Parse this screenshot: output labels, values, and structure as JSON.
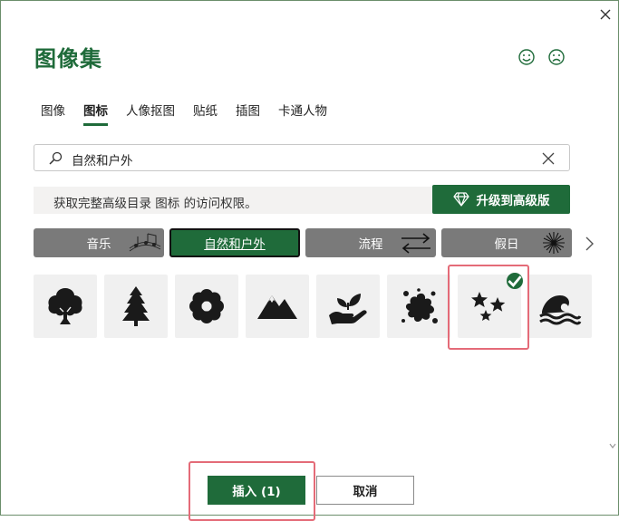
{
  "title": "图像集",
  "tabs": [
    {
      "label": "图像",
      "active": false
    },
    {
      "label": "图标",
      "active": true
    },
    {
      "label": "人像抠图",
      "active": false
    },
    {
      "label": "贴纸",
      "active": false
    },
    {
      "label": "插图",
      "active": false
    },
    {
      "label": "卡通人物",
      "active": false
    }
  ],
  "search": {
    "value": "自然和户外",
    "placeholder": ""
  },
  "banner": {
    "text": "获取完整高级目录 图标 的访问权限。",
    "upgrade_label": "升级到高级版"
  },
  "categories": [
    {
      "label": "音乐",
      "active": false
    },
    {
      "label": "自然和户外",
      "active": true
    },
    {
      "label": "流程",
      "active": false
    },
    {
      "label": "假日",
      "active": false
    }
  ],
  "icons": [
    {
      "name": "tree-icon",
      "selected": false
    },
    {
      "name": "pine-tree-icon",
      "selected": false
    },
    {
      "name": "flower-icon",
      "selected": false
    },
    {
      "name": "mountains-icon",
      "selected": false
    },
    {
      "name": "hand-plant-icon",
      "selected": false
    },
    {
      "name": "splash-icon",
      "selected": false
    },
    {
      "name": "stars-icon",
      "selected": true
    },
    {
      "name": "wave-icon",
      "selected": false
    }
  ],
  "buttons": {
    "insert_label": "插入 (1)",
    "cancel_label": "取消"
  },
  "colors": {
    "accent": "#1f6b3a",
    "tile": "#f0f0f0",
    "category": "#7a7a7a",
    "highlight": "#e46b78"
  }
}
